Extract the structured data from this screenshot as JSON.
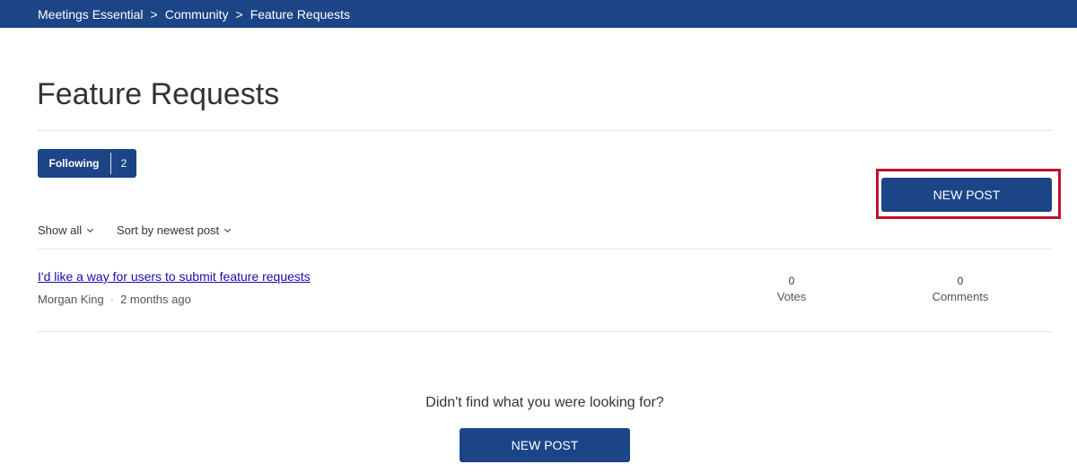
{
  "breadcrumb": {
    "items": [
      "Meetings Essential",
      "Community",
      "Feature Requests"
    ],
    "separator": ">"
  },
  "page": {
    "title": "Feature Requests"
  },
  "following": {
    "label": "Following",
    "count": "2"
  },
  "actions": {
    "new_post_label": "NEW POST"
  },
  "filters": {
    "show": "Show all",
    "sort": "Sort by newest post"
  },
  "posts": [
    {
      "title": "I'd like a way for users to submit feature requests",
      "author": "Morgan King",
      "separator": "·",
      "time": "2 months ago",
      "votes": "0",
      "votes_label": "Votes",
      "comments": "0",
      "comments_label": "Comments"
    }
  ],
  "footer": {
    "prompt": "Didn't find what you were looking for?",
    "new_post_label": "NEW POST"
  },
  "colors": {
    "brand": "#1c4587",
    "highlight": "#c0102f",
    "link": "#1a0dab"
  }
}
